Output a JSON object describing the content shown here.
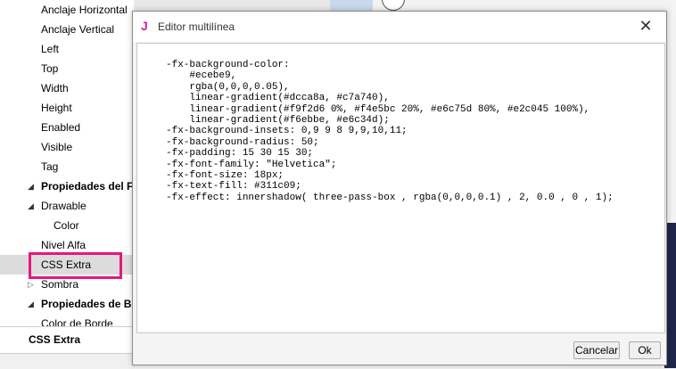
{
  "dialog": {
    "app_icon": "J",
    "title": "Editor multilínea",
    "close_symbol": "✕",
    "editor_text": "-fx-background-color:\n    #ecebe9,\n    rgba(0,0,0,0.05),\n    linear-gradient(#dcca8a, #c7a740),\n    linear-gradient(#f9f2d6 0%, #f4e5bc 20%, #e6c75d 80%, #e2c045 100%),\n    linear-gradient(#f6ebbe, #e6c34d);\n-fx-background-insets: 0,9 9 8 9,9,10,11;\n-fx-background-radius: 50;\n-fx-padding: 15 30 15 30;\n-fx-font-family: \"Helvetica\";\n-fx-font-size: 18px;\n-fx-text-fill: #311c09;\n-fx-effect: innershadow( three-pass-box , rgba(0,0,0,0.1) , 2, 0.0 , 0 , 1);",
    "cancel_label": "Cancelar",
    "ok_label": "Ok"
  },
  "properties": {
    "items": [
      {
        "label": "Anclaje Horizontal"
      },
      {
        "label": "Anclaje Vertical"
      },
      {
        "label": "Left"
      },
      {
        "label": "Top"
      },
      {
        "label": "Width"
      },
      {
        "label": "Height"
      },
      {
        "label": "Enabled"
      },
      {
        "label": "Visible"
      },
      {
        "label": "Tag"
      },
      {
        "label": "Propiedades del Fo"
      },
      {
        "label": "Drawable"
      },
      {
        "label": "Color"
      },
      {
        "label": "Nivel Alfa"
      },
      {
        "label": "CSS Extra"
      },
      {
        "label": "Sombra"
      },
      {
        "label": "Propiedades de Bo"
      },
      {
        "label": "Color de Borde"
      }
    ],
    "selected_label": "CSS Extra"
  },
  "colors": {
    "accent_highlight": "#e6197c",
    "app_icon": "#d3249a"
  }
}
